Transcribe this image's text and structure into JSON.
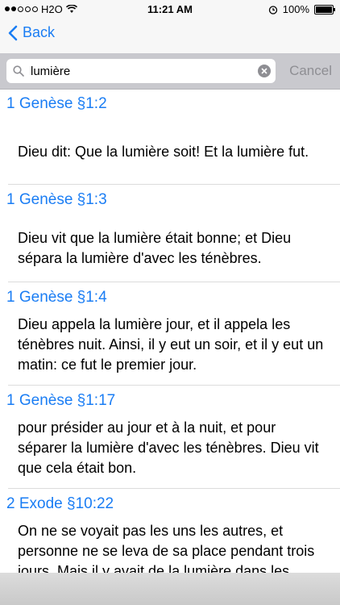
{
  "status": {
    "carrier": "H2O",
    "time": "11:21 AM",
    "battery": "100%"
  },
  "nav": {
    "back_label": "Back"
  },
  "search": {
    "query": "lumière",
    "cancel_label": "Cancel"
  },
  "results": [
    {
      "ref": "1 Genèse §1:2",
      "text": "Dieu dit: Que la lumière soit! Et la lumière fut."
    },
    {
      "ref": "1 Genèse §1:3",
      "text": "Dieu vit que la lumière était bonne; et Dieu sépara la lumière d'avec les ténèbres."
    },
    {
      "ref": "1 Genèse §1:4",
      "text": "Dieu appela la lumière jour, et il appela les ténèbres nuit. Ainsi, il y eut un soir, et il y eut un matin: ce fut le premier jour."
    },
    {
      "ref": "1 Genèse §1:17",
      "text": "pour présider au jour et à la nuit, et pour séparer la lumière d'avec les ténèbres. Dieu vit que cela était bon."
    },
    {
      "ref": "2 Exode §10:22",
      "text": "On ne se voyait pas les uns les autres, et personne ne se leva de sa place pendant trois jours. Mais il y avait de la lumière dans les"
    }
  ]
}
